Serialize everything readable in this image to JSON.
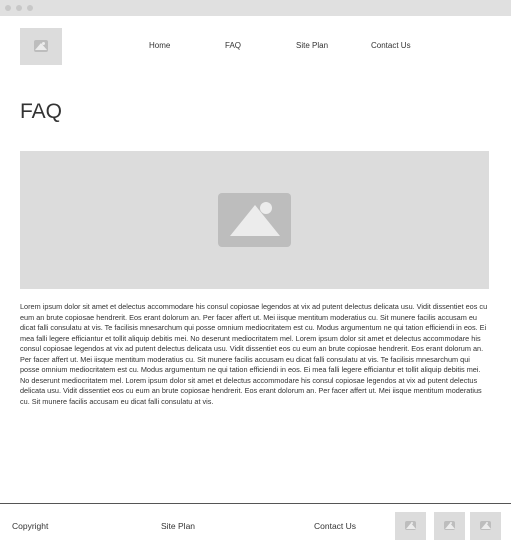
{
  "nav": {
    "items": [
      {
        "label": "Home"
      },
      {
        "label": "FAQ"
      },
      {
        "label": "Site Plan"
      },
      {
        "label": "Contact Us"
      }
    ]
  },
  "page": {
    "title": "FAQ"
  },
  "content": {
    "body": "Lorem ipsum dolor sit amet et delectus accommodare his consul copiosae legendos at vix ad putent delectus delicata usu. Vidit dissentiet eos cu eum an brute copiosae hendrerit. Eos erant dolorum an. Per facer affert ut. Mei iisque mentitum moderatius cu. Sit munere facilis accusam eu dicat falli consulatu at vis. Te facilisis mnesarchum qui posse omnium mediocritatem est cu. Modus argumentum ne qui tation efficiendi in eos. Ei mea falli legere efficiantur et tollit aliquip debitis mei. No deserunt mediocritatem mel. Lorem ipsum dolor sit amet et delectus accommodare his consul copiosae legendos at vix ad putent delectus delicata usu. Vidit dissentiet eos cu eum an brute copiosae hendrerit. Eos erant dolorum an. Per facer affert ut. Mei iisque mentitum moderatius cu. Sit munere facilis accusam eu dicat falli consulatu at vis. Te facilisis mnesarchum qui posse omnium mediocritatem est cu. Modus argumentum ne qui tation efficiendi in eos. Ei mea falli legere efficiantur et tollit aliquip debitis mei. No deserunt mediocritatem mel. Lorem ipsum dolor sit amet et delectus accommodare his consul copiosae legendos at vix ad putent delectus delicata usu. Vidit dissentiet eos cu eum an brute copiosae hendrerit. Eos erant dolorum an. Per facer affert ut. Mei iisque mentitum moderatius cu. Sit munere facilis accusam eu dicat falli consulatu at vis."
  },
  "footer": {
    "copyright": "Copyright",
    "site_plan": "Site Plan",
    "contact": "Contact Us"
  },
  "icons": {
    "logo": "image-placeholder-icon",
    "hero": "image-placeholder-icon",
    "social": [
      "image-placeholder-icon",
      "image-placeholder-icon",
      "image-placeholder-icon"
    ]
  },
  "colors": {
    "placeholder_bg": "#dcdcdc",
    "placeholder_icon": "#bdbdbd",
    "titlebar": "#e0e0e0",
    "text": "#333333"
  }
}
